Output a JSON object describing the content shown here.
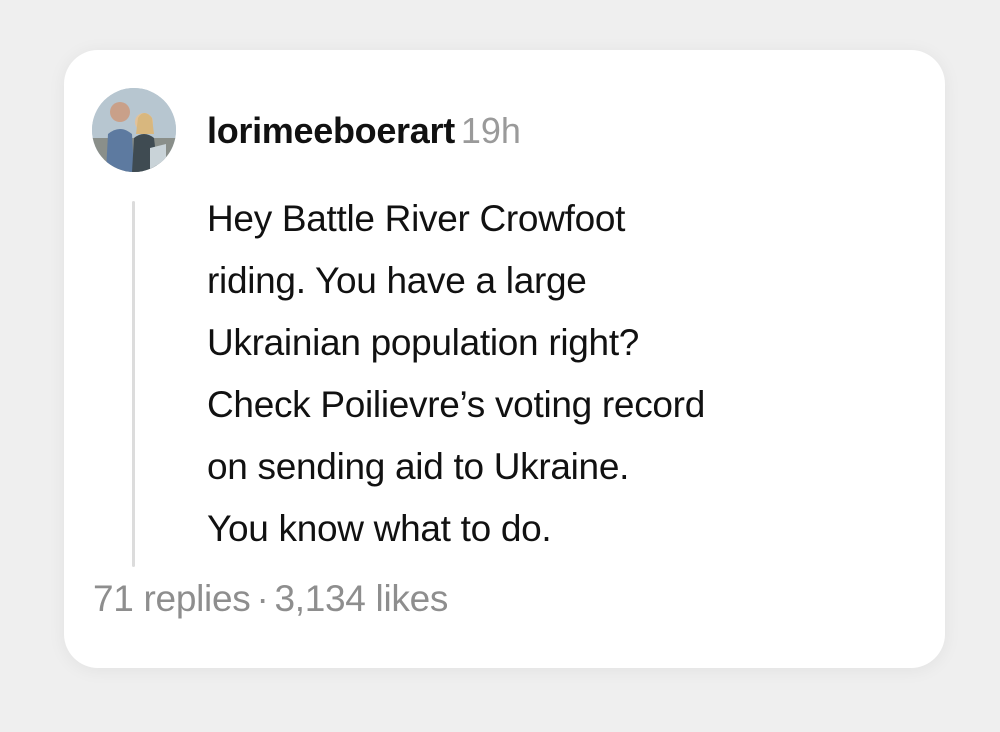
{
  "comment": {
    "username": "lorimeeboerart",
    "timestamp": "19h",
    "lines": [
      "Hey Battle River Crowfoot",
      "riding. You have a large",
      "Ukrainian population right?",
      "Check Poilievre’s voting record",
      "on sending aid to Ukraine.",
      "You know what to do."
    ],
    "replies": "71 replies",
    "separator": "·",
    "likes": "3,134 likes"
  },
  "colors": {
    "background": "#efefef",
    "card": "#ffffff",
    "text": "#111111",
    "muted": "#8e8e8e",
    "thread_line": "#dcdcdc"
  },
  "icons": {
    "avatar": "profile-photo"
  }
}
